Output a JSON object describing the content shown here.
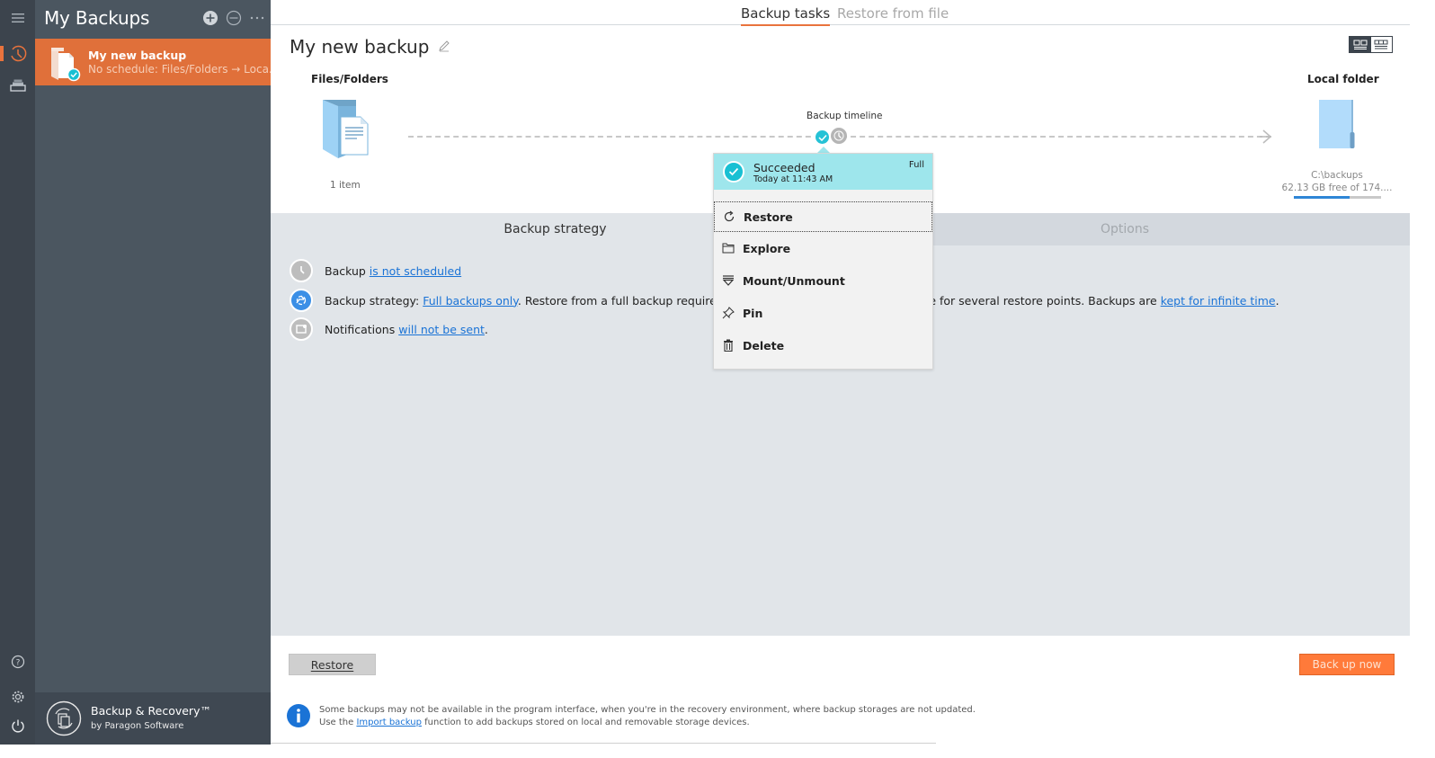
{
  "colors": {
    "accent": "#e9733d",
    "sidebar_bg": "#4b5660",
    "rail_bg": "#3c444d",
    "selected_item_bg": "#e0703a",
    "link": "#1a73d6",
    "success": "#18c0d3",
    "popup_header": "#9ee6ec",
    "backup_now_bg": "#ff7a3a"
  },
  "rail": {
    "items": [
      {
        "icon": "hamburger-menu-icon"
      },
      {
        "icon": "history-clock-icon",
        "active": true
      },
      {
        "icon": "storage-drive-icon"
      }
    ],
    "bottom_items": [
      {
        "icon": "help-icon"
      },
      {
        "icon": "gear-icon"
      },
      {
        "icon": "power-icon"
      }
    ]
  },
  "sidebar": {
    "title": "My Backups",
    "header_actions": [
      {
        "icon": "add-icon",
        "label": "Add"
      },
      {
        "icon": "remove-icon",
        "label": "Remove"
      },
      {
        "icon": "more-icon",
        "label": "More"
      }
    ],
    "items": [
      {
        "name": "My new backup",
        "subtitle": "No schedule: Files/Folders → Loca...",
        "icon": "backup-files-icon",
        "status_icon": "success-check-icon",
        "selected": true
      }
    ],
    "footer": {
      "product": "Backup & Recovery™",
      "vendor": "by Paragon Software"
    }
  },
  "tabs": [
    {
      "label": "Backup tasks",
      "active": true
    },
    {
      "label": "Restore from file",
      "active": false
    }
  ],
  "task": {
    "title": "My new backup",
    "source": {
      "label": "Files/Folders",
      "count": "1 item"
    },
    "timeline": {
      "label": "Backup timeline",
      "points": [
        {
          "status": "succeeded",
          "icon": "success-check-icon"
        },
        {
          "status": "scheduled",
          "icon": "clock-icon"
        }
      ]
    },
    "destination": {
      "label": "Local folder",
      "path": "C:\\backups",
      "free": "62.13 GB free of 174....",
      "usage_fraction": 0.64
    }
  },
  "view_toggle": [
    {
      "icon": "tile-view-icon",
      "active": true
    },
    {
      "icon": "list-view-icon",
      "active": false
    }
  ],
  "panel": {
    "tabs": [
      {
        "label": "Backup strategy",
        "active": true
      },
      {
        "label": "Options",
        "active": false
      }
    ],
    "rows": [
      {
        "icon": "clock-icon",
        "prefix": "Backup ",
        "link": "is not scheduled",
        "suffix": ""
      },
      {
        "icon": "recycle-icon",
        "prefix": "Backup strategy: ",
        "link": "Full backups only",
        "middle": ". Restore from a full backup requires the minimum of time but more space for several restore points. Backups are ",
        "link2": "kept for infinite time",
        "suffix": "."
      },
      {
        "icon": "notification-icon",
        "prefix": "Notifications ",
        "link": "will not be sent",
        "suffix": "."
      }
    ]
  },
  "popup": {
    "status": "Succeeded",
    "time": "Today at 11:43 AM",
    "type": "Full",
    "menu": [
      {
        "label": "Restore",
        "icon": "restore-icon",
        "focused": true
      },
      {
        "label": "Explore",
        "icon": "folder-icon"
      },
      {
        "label": "Mount/Unmount",
        "icon": "mount-icon"
      },
      {
        "label": "Pin",
        "icon": "pin-icon"
      },
      {
        "label": "Delete",
        "icon": "trash-icon"
      }
    ]
  },
  "footer": {
    "restore_label": "Restore",
    "backup_now_label": "Back up now",
    "info_line1": "Some backups may not be available in the program interface, when you're in the recovery environment, where backup storages are not updated.",
    "info_line2_prefix": "Use the ",
    "info_line2_link": "Import backup",
    "info_line2_suffix": " function to add backups stored on local and removable storage devices."
  }
}
